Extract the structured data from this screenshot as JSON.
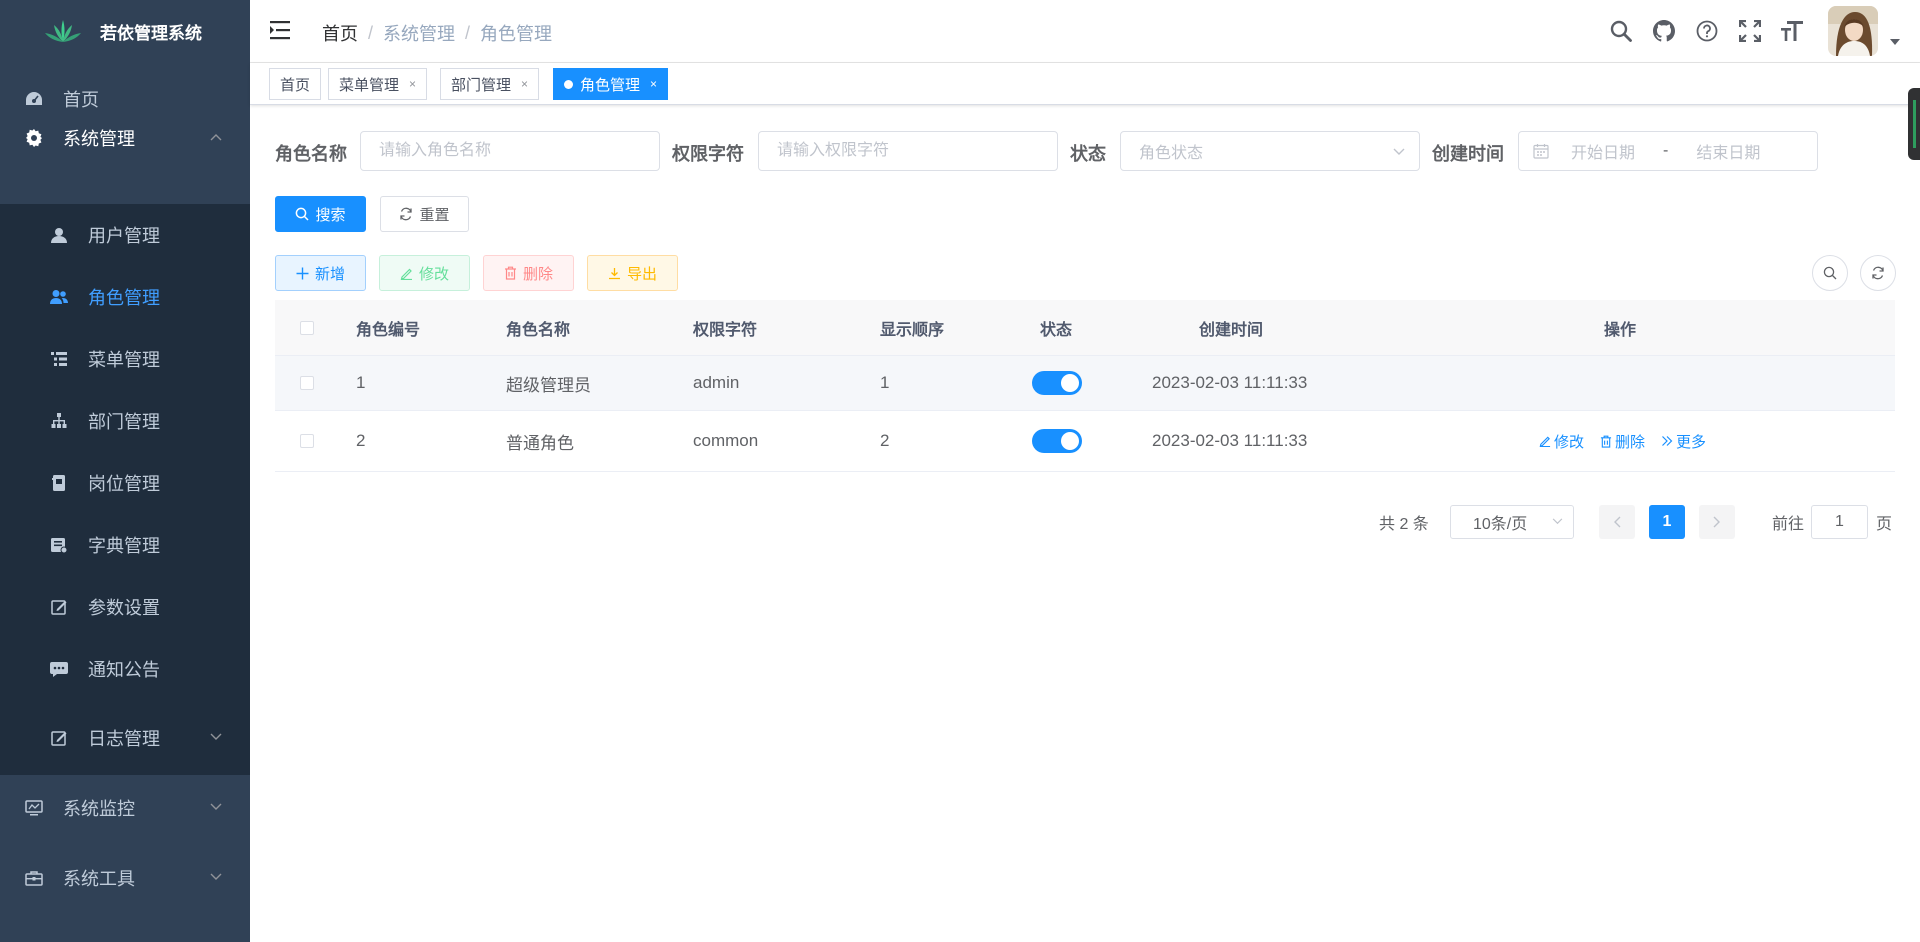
{
  "app": {
    "title": "若依管理系统"
  },
  "sidebar": {
    "items": [
      {
        "label": "首页",
        "icon": "dashboard-icon"
      },
      {
        "label": "系统管理",
        "icon": "gear-icon",
        "expanded": true,
        "children": [
          {
            "label": "用户管理",
            "icon": "user-icon"
          },
          {
            "label": "角色管理",
            "icon": "peoples-icon",
            "active": true
          },
          {
            "label": "菜单管理",
            "icon": "tree-table-icon"
          },
          {
            "label": "部门管理",
            "icon": "tree-icon"
          },
          {
            "label": "岗位管理",
            "icon": "post-icon"
          },
          {
            "label": "字典管理",
            "icon": "dict-icon"
          },
          {
            "label": "参数设置",
            "icon": "edit-icon"
          },
          {
            "label": "通知公告",
            "icon": "message-icon"
          },
          {
            "label": "日志管理",
            "icon": "log-icon"
          }
        ]
      },
      {
        "label": "系统监控",
        "icon": "monitor-icon"
      },
      {
        "label": "系统工具",
        "icon": "tool-icon"
      }
    ]
  },
  "navbar": {
    "breadcrumb": [
      "首页",
      "系统管理",
      "角色管理"
    ],
    "tools": [
      "search-icon",
      "github-icon",
      "question-icon",
      "fullscreen-icon",
      "font-size-icon"
    ]
  },
  "tags": [
    {
      "label": "首页",
      "closable": false
    },
    {
      "label": "菜单管理",
      "closable": true
    },
    {
      "label": "部门管理",
      "closable": true
    },
    {
      "label": "角色管理",
      "closable": true,
      "active": true
    }
  ],
  "tag_close": "×",
  "search": {
    "role_name_label": "角色名称",
    "role_name_placeholder": "请输入角色名称",
    "role_key_label": "权限字符",
    "role_key_placeholder": "请输入权限字符",
    "status_label": "状态",
    "status_placeholder": "角色状态",
    "date_label": "创建时间",
    "start_placeholder": "开始日期",
    "range_sep": "-",
    "end_placeholder": "结束日期",
    "search_btn": "搜索",
    "reset_btn": "重置"
  },
  "toolbar": {
    "add": "新增",
    "edit": "修改",
    "delete": "删除",
    "export": "导出"
  },
  "table": {
    "columns": [
      "角色编号",
      "角色名称",
      "权限字符",
      "显示顺序",
      "状态",
      "创建时间",
      "操作"
    ],
    "rows": [
      {
        "id": "1",
        "name": "超级管理员",
        "key": "admin",
        "sort": "1",
        "status": true,
        "created": "2023-02-03 11:11:33"
      },
      {
        "id": "2",
        "name": "普通角色",
        "key": "common",
        "sort": "2",
        "status": true,
        "created": "2023-02-03 11:11:33"
      }
    ],
    "row_actions": {
      "edit": "修改",
      "delete": "删除",
      "more": "更多"
    }
  },
  "pagination": {
    "total": "共 2 条",
    "page_size": "10条/页",
    "current": "1",
    "goto_label": "前往",
    "goto_value": "1",
    "goto_suffix": "页"
  },
  "colors": {
    "sidebar_bg": "#304156",
    "submenu_bg": "#1f2d3d",
    "primary": "#1890ff",
    "menu_text": "#bfcbd9"
  }
}
